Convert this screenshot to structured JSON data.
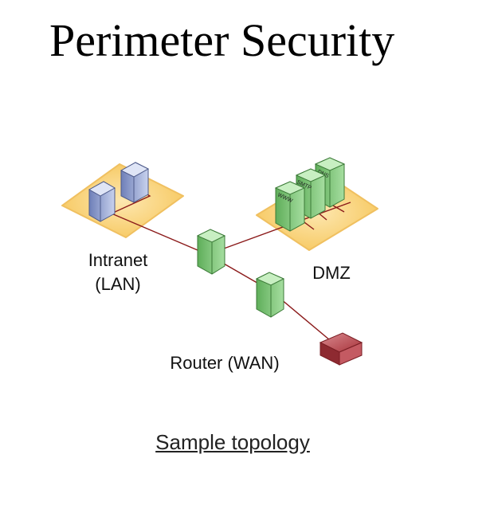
{
  "title": "Perimeter Security",
  "labels": {
    "intranet_line1": "Intranet",
    "intranet_line2": "(LAN)",
    "dmz": "DMZ",
    "router": "Router (WAN)"
  },
  "servers": {
    "www": "WWW",
    "smtp": "SMTP",
    "dns": "DNS"
  },
  "caption": "Sample topology",
  "colors": {
    "zone_fill": "#fcd98a",
    "link": "#8b1a1a",
    "firewall": "#7fc27a",
    "router": "#a8333a",
    "workstation": "#8c9cc8"
  }
}
